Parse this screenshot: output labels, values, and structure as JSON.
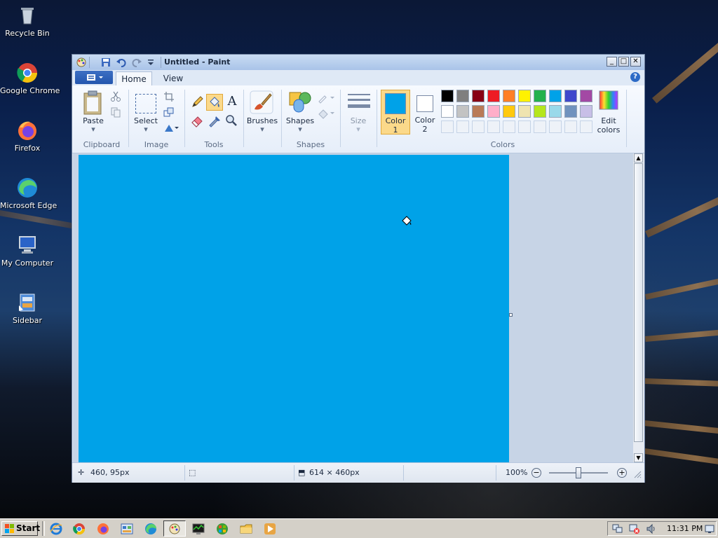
{
  "desktop": {
    "icons": [
      {
        "label": "Recycle Bin"
      },
      {
        "label": "Google Chrome"
      },
      {
        "label": "Firefox"
      },
      {
        "label": "Microsoft Edge"
      },
      {
        "label": "My Computer"
      },
      {
        "label": "Sidebar"
      }
    ]
  },
  "window": {
    "title": "Untitled - Paint",
    "controls": {
      "minimize": "_",
      "maximize": "□",
      "close": "✕"
    }
  },
  "ribbon": {
    "tabs": [
      {
        "label": "Home"
      },
      {
        "label": "View"
      }
    ],
    "help": "?",
    "groups": {
      "clipboard": "Clipboard",
      "image": "Image",
      "tools": "Tools",
      "shapes": "Shapes",
      "colors": "Colors"
    },
    "buttons": {
      "paste": "Paste",
      "select": "Select",
      "brushes": "Brushes",
      "shapes": "Shapes",
      "size": "Size",
      "color1_a": "Color",
      "color1_b": "1",
      "color2_a": "Color",
      "color2_b": "2",
      "edit_colors_a": "Edit",
      "edit_colors_b": "colors",
      "text_tool": "A"
    },
    "color1": "#00a2e8",
    "color2": "#ffffff",
    "palette_row1": [
      "#000000",
      "#7f7f7f",
      "#880015",
      "#ed1c24",
      "#ff7f27",
      "#fff200",
      "#22b14c",
      "#00a2e8",
      "#3f48cc",
      "#a349a4"
    ],
    "palette_row2": [
      "#ffffff",
      "#c3c3c3",
      "#b97a57",
      "#ffaec9",
      "#ffc90e",
      "#efe4b0",
      "#b5e61d",
      "#99d9ea",
      "#7092be",
      "#c8bfe7"
    ]
  },
  "canvas": {
    "fill_color": "#00a2e8"
  },
  "statusbar": {
    "cursor_pos": "460, 95px",
    "selection_size": "",
    "image_size": "614 × 460px",
    "zoom": "100%",
    "zoom_out": "−",
    "zoom_in": "+"
  },
  "taskbar": {
    "start": "Start",
    "clock": "11:31 PM"
  }
}
